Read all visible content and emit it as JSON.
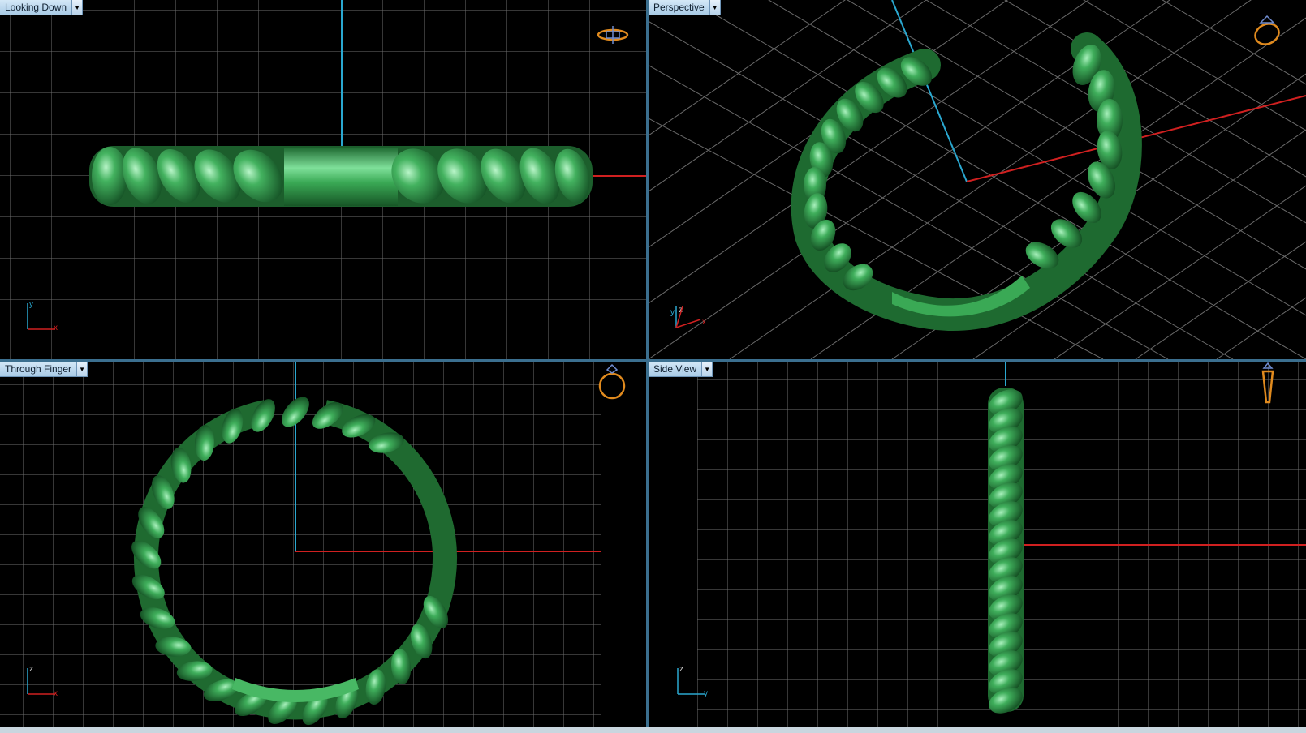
{
  "viewports": [
    {
      "id": "looking-down",
      "label": "Looking Down",
      "axes": [
        "y",
        "x"
      ]
    },
    {
      "id": "perspective",
      "label": "Perspective",
      "axes": [
        "z",
        "y",
        "x"
      ]
    },
    {
      "id": "through-finger",
      "label": "Through Finger",
      "axes": [
        "z",
        "x"
      ]
    },
    {
      "id": "side-view",
      "label": "Side View",
      "axes": [
        "z",
        "y"
      ]
    }
  ],
  "colors": {
    "background": "#000000",
    "grid": "#6e6e6e",
    "x_axis": "#d02020",
    "vertical_axis": "#2aa8d0",
    "model": "#2f9a4a",
    "orient_icon": "#e08a1e",
    "label_bg": "#bcd8ef"
  },
  "icons": [
    "dropdown-arrow-icon",
    "ring-orientation-icon"
  ]
}
